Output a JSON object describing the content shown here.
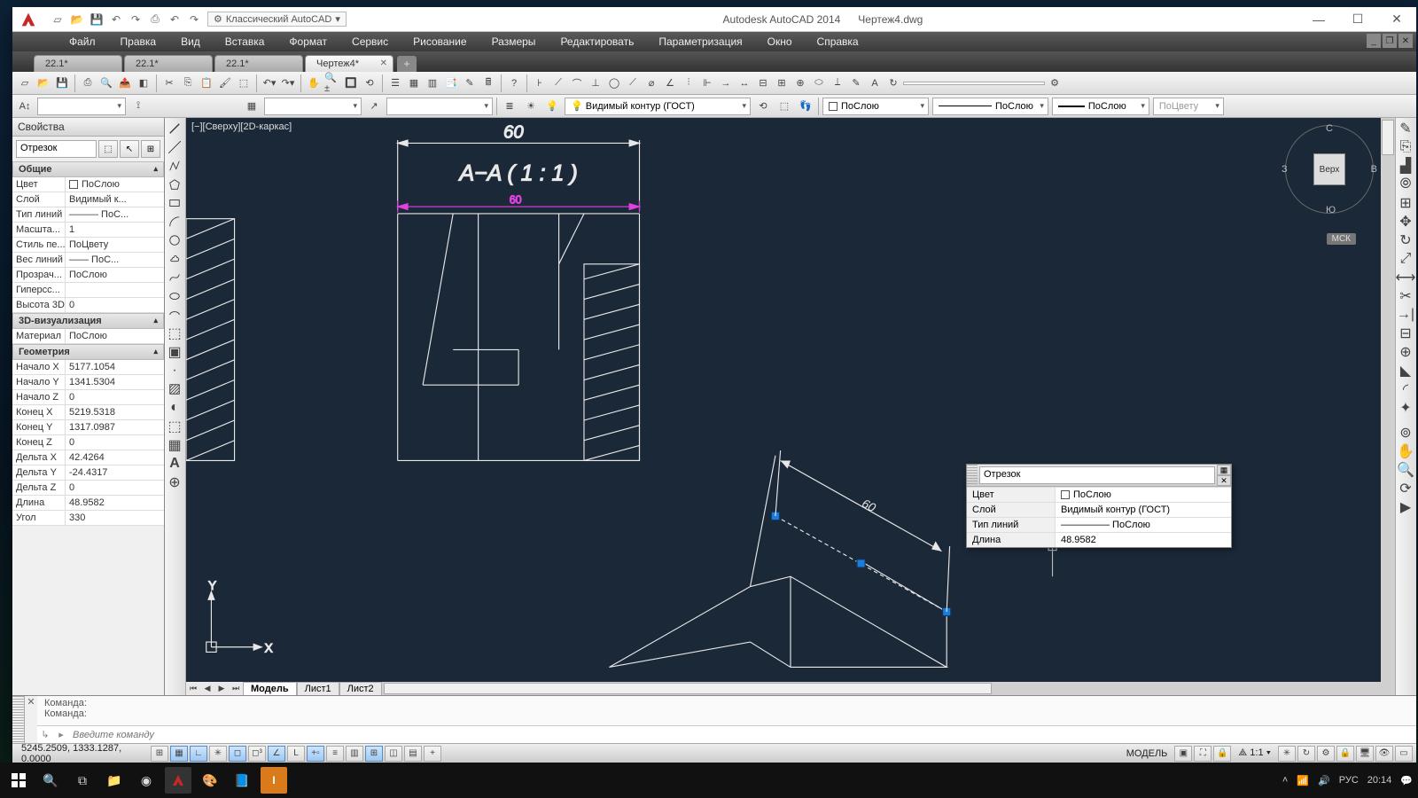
{
  "app_title": "Autodesk AutoCAD 2014",
  "doc_name": "Чертеж4.dwg",
  "workspace": "Классический AutoCAD",
  "menus": [
    "Файл",
    "Правка",
    "Вид",
    "Вставка",
    "Формат",
    "Сервис",
    "Рисование",
    "Размеры",
    "Редактировать",
    "Параметризация",
    "Окно",
    "Справка"
  ],
  "filetabs": [
    {
      "label": "22.1*",
      "active": false
    },
    {
      "label": "22.1*",
      "active": false
    },
    {
      "label": "22.1*",
      "active": false
    },
    {
      "label": "Чертеж4*",
      "active": true
    }
  ],
  "layer_combo": "Видимый контур (ГОСТ)",
  "color_combo": "ПоСлою",
  "linetype_combo": "ПоСлою",
  "lineweight_combo": "ПоСлою",
  "plotstyle_combo": "ПоЦвету",
  "canvas_view_label": "[−][Сверху][2D-каркас]",
  "viewcube": {
    "top": "Верх",
    "n": "С",
    "e": "В",
    "s": "Ю",
    "w": "З",
    "wcs": "МСК"
  },
  "dim_text_top": "60",
  "section_label": "A−A ( 1 : 1 )",
  "dim_magenta": "60",
  "dim_iso": "60",
  "ucs_x": "X",
  "ucs_y": "Y",
  "properties": {
    "title": "Свойства",
    "selection": "Отрезок",
    "groups": {
      "general": {
        "hdr": "Общие",
        "rows": [
          {
            "k": "Цвет",
            "v": "ПоСлою",
            "swatch": true
          },
          {
            "k": "Слой",
            "v": "Видимый к..."
          },
          {
            "k": "Тип линий",
            "v": "——— ПоС..."
          },
          {
            "k": "Масшта...",
            "v": "1"
          },
          {
            "k": "Стиль пе...",
            "v": "ПоЦвету"
          },
          {
            "k": "Вес линий",
            "v": "—— ПоС..."
          },
          {
            "k": "Прозрач...",
            "v": "ПоСлою"
          },
          {
            "k": "Гиперсс...",
            "v": ""
          },
          {
            "k": "Высота 3D",
            "v": "0"
          }
        ]
      },
      "viz3d": {
        "hdr": "3D-визуализация",
        "rows": [
          {
            "k": "Материал",
            "v": "ПоСлою"
          }
        ]
      },
      "geom": {
        "hdr": "Геометрия",
        "rows": [
          {
            "k": "Начало X",
            "v": "5177.1054"
          },
          {
            "k": "Начало Y",
            "v": "1341.5304"
          },
          {
            "k": "Начало Z",
            "v": "0"
          },
          {
            "k": "Конец X",
            "v": "5219.5318"
          },
          {
            "k": "Конец Y",
            "v": "1317.0987"
          },
          {
            "k": "Конец Z",
            "v": "0"
          },
          {
            "k": "Дельта X",
            "v": "42.4264"
          },
          {
            "k": "Дельта Y",
            "v": "-24.4317"
          },
          {
            "k": "Дельта Z",
            "v": "0"
          },
          {
            "k": "Длина",
            "v": "48.9582"
          },
          {
            "k": "Угол",
            "v": "330"
          }
        ]
      }
    }
  },
  "quick_props": {
    "selection": "Отрезок",
    "rows": [
      {
        "k": "Цвет",
        "v": "ПоСлою",
        "swatch": true
      },
      {
        "k": "Слой",
        "v": "Видимый контур (ГОСТ)"
      },
      {
        "k": "Тип линий",
        "v": "————— ПоСлою"
      },
      {
        "k": "Длина",
        "v": "48.9582"
      }
    ]
  },
  "model_tabs": [
    "Модель",
    "Лист1",
    "Лист2"
  ],
  "cmd_history": [
    "Команда:",
    "Команда:"
  ],
  "cmd_placeholder": "Введите команду",
  "status": {
    "coords": "5245.2509, 1333.1287, 0.0000",
    "model": "МОДЕЛЬ",
    "scale": "1:1"
  },
  "tray": {
    "lang": "РУС",
    "time": "20:14"
  }
}
